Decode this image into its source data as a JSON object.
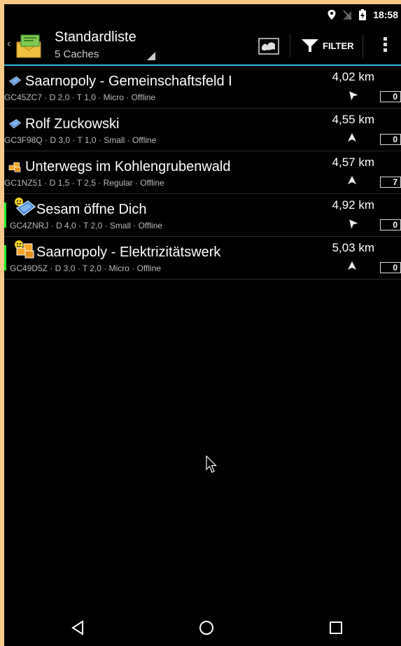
{
  "status_bar": {
    "time": "18:58"
  },
  "action_bar": {
    "title": "Standardliste",
    "subtitle": "5 Caches",
    "filter_label": "FILTER"
  },
  "caches": [
    {
      "name": "Saarnopoly - Gemeinschaftsfeld I",
      "info": "GC45ZC7 · D 2,0 · T 1,0 · Micro · Offline",
      "distance": "4,02 km",
      "count": "0",
      "type": "mystery-cache-icon",
      "found": false
    },
    {
      "name": "Rolf Zuckowski",
      "info": "GC3F98Q · D 3,0 · T 1,0 · Small · Offline",
      "distance": "4,55 km",
      "count": "0",
      "type": "mystery-cache-icon",
      "found": false
    },
    {
      "name": "Unterwegs im Kohlengrubenwald",
      "info": "GC1NZ51 · D 1,5 · T 2,5 · Regular · Offline",
      "distance": "4,57 km",
      "count": "7",
      "type": "multi-cache-icon",
      "found": false
    },
    {
      "name": "Sesam öffne Dich",
      "info": "GC4ZNRJ · D 4,0 · T 2,0 · Small · Offline",
      "distance": "4,92 km",
      "count": "0",
      "type": "mystery-cache-icon",
      "found": true
    },
    {
      "name": "Saarnopoly - Elektrizitätswerk",
      "info": "GC49D5Z · D 3,0 · T 2,0 · Micro · Offline",
      "distance": "5,03 km",
      "count": "0",
      "type": "multi-cache-icon",
      "found": true
    }
  ],
  "colors": {
    "accent": "#33b5e5",
    "found_marker": "#22ee22",
    "background": "#000000"
  }
}
